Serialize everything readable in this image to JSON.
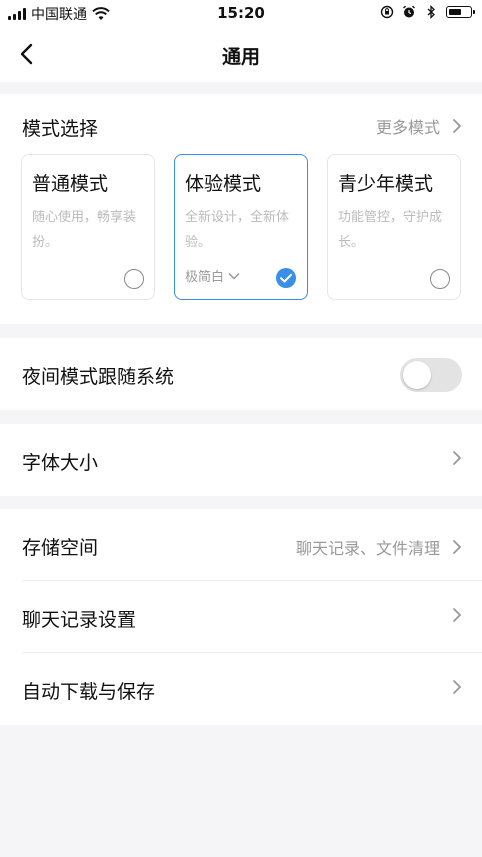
{
  "status_bar": {
    "carrier": "中国联通",
    "time": "15:20",
    "icons": [
      "signal-icon",
      "wifi-icon",
      "lock-rotation-icon",
      "alarm-icon",
      "bluetooth-icon",
      "battery-icon"
    ]
  },
  "nav": {
    "title": "通用",
    "back_icon": "chevron-left-icon"
  },
  "mode_section": {
    "title": "模式选择",
    "more_label": "更多模式",
    "modes": [
      {
        "title": "普通模式",
        "description": "随心使用，畅享装扮。",
        "selected": false
      },
      {
        "title": "体验模式",
        "description": "全新设计，全新体验。",
        "theme": "极简白",
        "selected": true
      },
      {
        "title": "青少年模式",
        "description": "功能管控，守护成长。",
        "selected": false
      }
    ]
  },
  "night_mode": {
    "label": "夜间模式跟随系统",
    "enabled": false
  },
  "font_size": {
    "label": "字体大小"
  },
  "storage_group": {
    "items": [
      {
        "label": "存储空间",
        "detail": "聊天记录、文件清理"
      },
      {
        "label": "聊天记录设置",
        "detail": ""
      },
      {
        "label": "自动下载与保存",
        "detail": ""
      }
    ]
  },
  "colors": {
    "accent": "#3a8ee6",
    "background": "#f5f5f7",
    "muted_text": "#999999"
  }
}
